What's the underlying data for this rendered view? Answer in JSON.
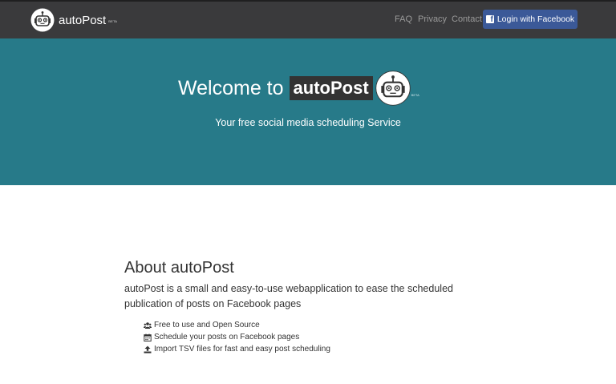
{
  "nav": {
    "brand": "autoPost",
    "brand_beta": "BETA",
    "links": [
      "FAQ",
      "Privacy",
      "Contact"
    ],
    "login_label": "Login with Facebook"
  },
  "hero": {
    "welcome": "Welcome to",
    "badge": "autoPost",
    "beta": "BETA",
    "subtitle": "Your free social media scheduling Service"
  },
  "about": {
    "heading": "About autoPost",
    "description": "autoPost is a small and easy-to-use webapplication to ease the scheduled publication of posts on Facebook pages",
    "features": [
      {
        "icon": "users-icon",
        "text": "Free to use and Open Source"
      },
      {
        "icon": "calendar-icon",
        "text": "Schedule your posts on Facebook pages"
      },
      {
        "icon": "upload-icon",
        "text": "Import TSV files for fast and easy post scheduling"
      }
    ]
  },
  "colors": {
    "navbar": "#3a3a3c",
    "hero": "#277a89",
    "facebook": "#3b5998"
  }
}
